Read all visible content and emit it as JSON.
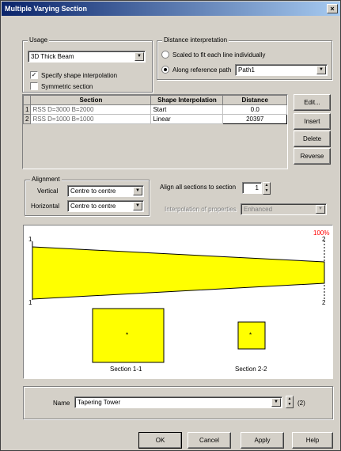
{
  "window": {
    "title": "Multiple Varying Section",
    "close": "×"
  },
  "usage": {
    "legend": "Usage",
    "type_value": "3D Thick Beam",
    "specify_interp_label": "Specify shape interpolation",
    "specify_interp_checked": true,
    "symmetric_label": "Symmetric section",
    "symmetric_checked": false
  },
  "distance_interp": {
    "legend": "Distance interpretation",
    "opt_scaled": "Scaled to fit each line individually",
    "opt_along": "Along reference path",
    "selected": "opt_along",
    "path_value": "Path1"
  },
  "table": {
    "headers": [
      "Section",
      "Shape Interpolation",
      "Distance"
    ],
    "rows": [
      {
        "num": "1",
        "section": "RSS D=3000 B=2000",
        "interp": "Start",
        "distance": "0.0"
      },
      {
        "num": "2",
        "section": "RSS D=1000 B=1000",
        "interp": "Linear",
        "distance": "20397"
      }
    ]
  },
  "side_buttons": {
    "edit": "Edit...",
    "insert": "Insert",
    "delete": "Delete",
    "reverse": "Reverse"
  },
  "alignment": {
    "legend": "Alignment",
    "vertical_label": "Vertical",
    "vertical_value": "Centre to centre",
    "horizontal_label": "Horizontal",
    "horizontal_value": "Centre to centre"
  },
  "align_all": {
    "label": "Align all sections to section",
    "value": "1"
  },
  "interp_props": {
    "label": "Interpolation of properties",
    "value": "Enhanced"
  },
  "preview": {
    "percent": "100%",
    "left_top": "1",
    "left_bottom": "1",
    "right_top": "2",
    "right_bottom": "2",
    "section1_label": "Section 1-1",
    "section2_label": "Section 2-2",
    "centroid": "*",
    "fill_color": "#ffff00"
  },
  "name_row": {
    "label": "Name",
    "value": "Tapering Tower",
    "count": "(2)"
  },
  "footer": {
    "ok": "OK",
    "cancel": "Cancel",
    "apply": "Apply",
    "help": "Help"
  },
  "icons": {
    "dropdown": "▼",
    "spin_up": "▲",
    "spin_down": "▼"
  }
}
